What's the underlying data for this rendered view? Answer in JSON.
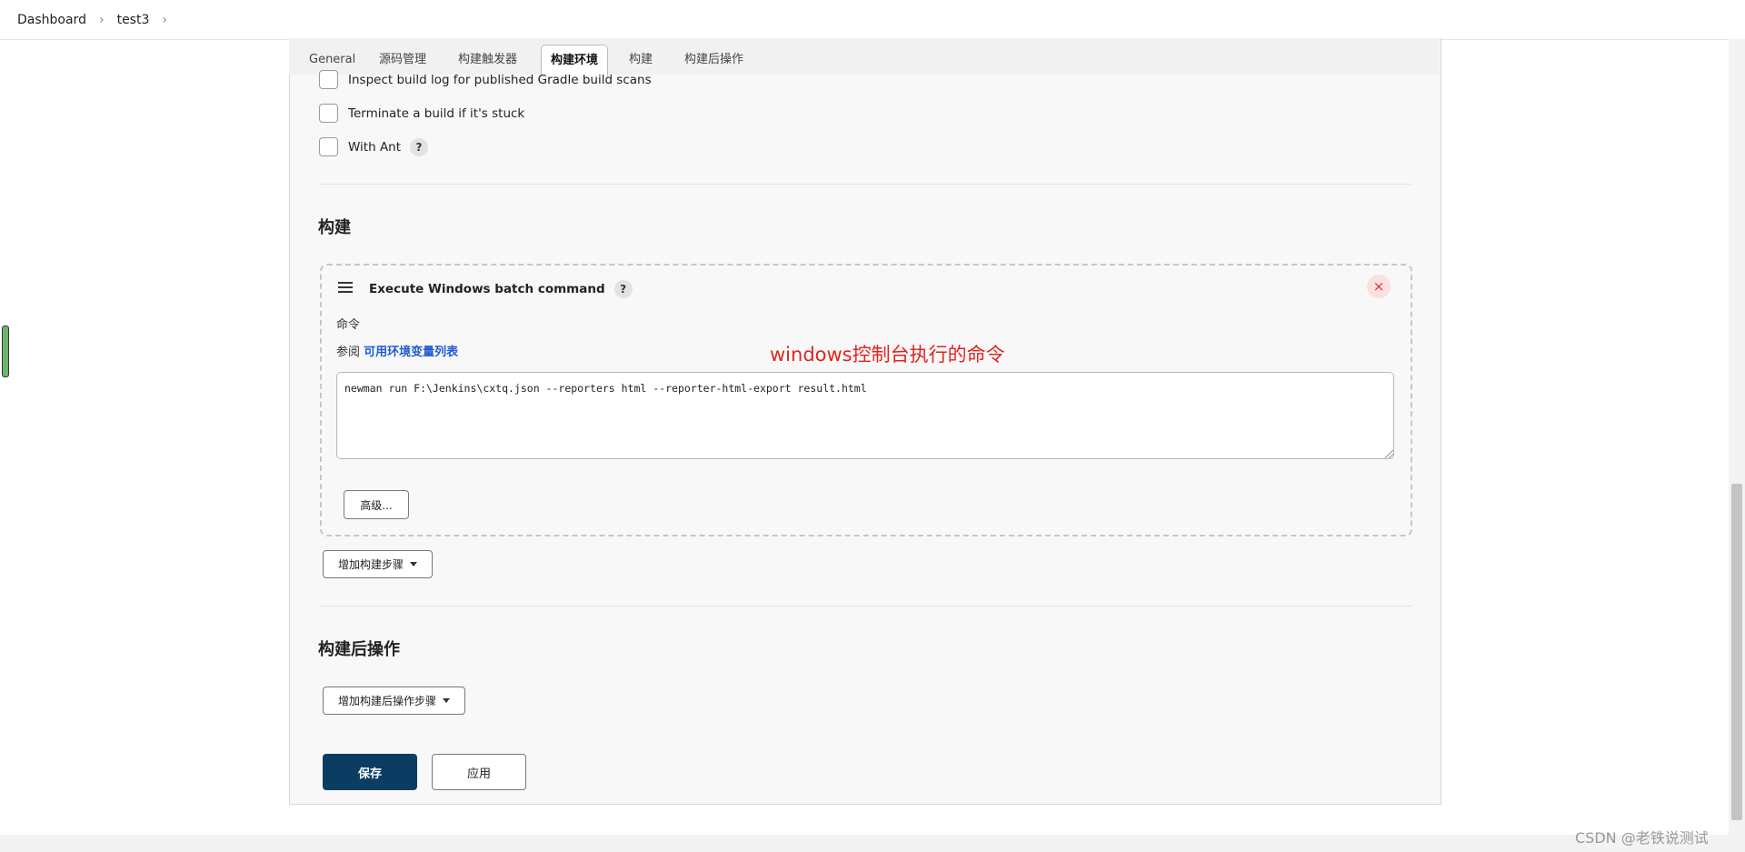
{
  "breadcrumb": {
    "items": [
      "Dashboard",
      "test3"
    ]
  },
  "tabs": [
    "General",
    "源码管理",
    "构建触发器",
    "构建环境",
    "构建",
    "构建后操作"
  ],
  "active_tab": "构建环境",
  "build_env_options": [
    {
      "label": "Inspect build log for published Gradle build scans",
      "checked": false
    },
    {
      "label": "Terminate a build if it's stuck",
      "checked": false
    },
    {
      "label": "With Ant",
      "checked": false,
      "help": "?"
    }
  ],
  "build_section": {
    "title": "构建",
    "step": {
      "title": "Execute Windows batch command",
      "help": "?",
      "close": "×",
      "command_label": "命令",
      "env_prefix": "参阅",
      "env_link": "可用环境变量列表",
      "command_value": "newman run F:\\Jenkins\\cxtq.json --reporters html --reporter-html-export result.html",
      "advanced_button": "高级..."
    },
    "add_step_button": "增加构建步骤"
  },
  "annotation": "windows控制台执行的命令",
  "post_build_section": {
    "title": "构建后操作",
    "add_step_button": "增加构建后操作步骤"
  },
  "actions": {
    "save": "保存",
    "apply": "应用"
  },
  "watermark": "CSDN @老铁说测试",
  "colors": {
    "save_bg": "#0b3d62",
    "link": "#1d5bd1",
    "annotation": "#e0241f",
    "close_bg": "#fbe0e0"
  },
  "icons": {
    "breadcrumb_separator": "chevron-right-icon",
    "drag": "drag-handle-icon",
    "close": "close-icon",
    "dropdown": "caret-down-icon"
  }
}
